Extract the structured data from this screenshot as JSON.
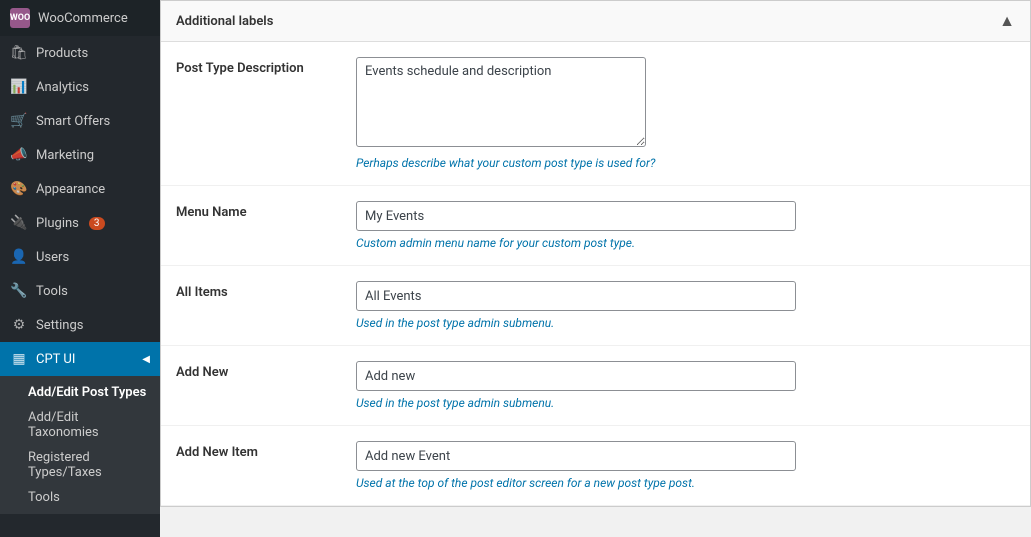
{
  "sidebar": {
    "brand": "WooCommerce",
    "brand_abbr": "WOO",
    "items": [
      {
        "id": "products",
        "label": "Products",
        "icon": "🛍"
      },
      {
        "id": "analytics",
        "label": "Analytics",
        "icon": "📊"
      },
      {
        "id": "smart-offers",
        "label": "Smart Offers",
        "icon": "🛒"
      },
      {
        "id": "marketing",
        "label": "Marketing",
        "icon": "📣"
      },
      {
        "id": "appearance",
        "label": "Appearance",
        "icon": "🎨"
      },
      {
        "id": "plugins",
        "label": "Plugins",
        "icon": "🔌",
        "badge": "3"
      },
      {
        "id": "users",
        "label": "Users",
        "icon": "👤"
      },
      {
        "id": "tools",
        "label": "Tools",
        "icon": "🔧"
      },
      {
        "id": "settings",
        "label": "Settings",
        "icon": "⚙"
      }
    ],
    "cpt_ui": {
      "label": "CPT UI",
      "icon": "▦",
      "sub_items": [
        {
          "id": "add-edit-post-types",
          "label": "Add/Edit Post Types"
        },
        {
          "id": "add-edit-taxonomies",
          "label": "Add/Edit Taxonomies"
        },
        {
          "id": "registered-types-taxes",
          "label": "Registered Types/Taxes"
        },
        {
          "id": "tools-sub",
          "label": "Tools"
        }
      ]
    }
  },
  "main": {
    "section_title": "Additional labels",
    "toggle_icon": "▲",
    "fields": {
      "post_type_description": {
        "label": "Post Type Description",
        "value": "Events schedule and description",
        "hint": "Perhaps describe what your custom post type is used for?"
      },
      "menu_name": {
        "label": "Menu Name",
        "value": "My Events",
        "hint": "Custom admin menu name for your custom post type."
      },
      "all_items": {
        "label": "All Items",
        "value": "All Events",
        "hint": "Used in the post type admin submenu."
      },
      "add_new": {
        "label": "Add New",
        "value": "Add new",
        "hint": "Used in the post type admin submenu."
      },
      "add_new_item": {
        "label": "Add New Item",
        "value": "Add new Event",
        "hint": "Used at the top of the post editor screen for a new post type post."
      }
    }
  }
}
